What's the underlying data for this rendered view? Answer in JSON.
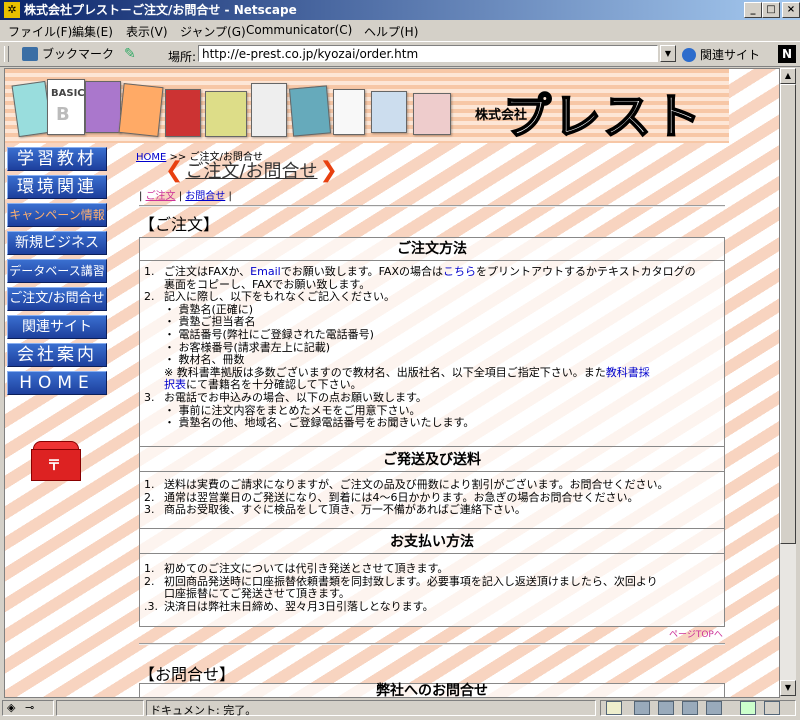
{
  "window": {
    "title": "株式会社プレスト－ご注文/お問合せ - Netscape",
    "minimize": "_",
    "maximize": "□",
    "close": "×"
  },
  "menu": [
    "ファイル(F)",
    "編集(E)",
    "表示(V)",
    "ジャンプ(G)",
    "Communicator(C)",
    "ヘルプ(H)"
  ],
  "toolbar": {
    "bookmarks": "ブックマーク",
    "location_label": "場所:",
    "location_url": "http://e-prest.co.jp/kyozai/order.htm",
    "related": "関連サイト",
    "logo": "N"
  },
  "banner": {
    "company_prefix": "株式会社",
    "company_name": "プレスト",
    "book_text": "BASIC"
  },
  "nav": [
    "学習教材",
    "環境関連",
    "キャンペーン情報",
    "新規ビジネス",
    "データベース講習",
    "ご注文/お問合せ",
    "関連サイト",
    "会社案内",
    "HOME"
  ],
  "mailbox_mark": "〒",
  "breadcrumb": {
    "home": "HOME",
    "sep": " >> ",
    "current": "ご注文/お問合せ"
  },
  "heading": {
    "title": "ご注文/お問合せ",
    "left_arrow": "❮",
    "right_arrow": "❯"
  },
  "sublinks": {
    "open": "| ",
    "order": "ご注文",
    "mid": " | ",
    "inquiry": "お問合せ",
    "close": " |"
  },
  "order_section": "【ご注文】",
  "order_method": {
    "title": "ご注文方法",
    "item1": {
      "num": "1.",
      "pre": "ご注文はFAXか、",
      "email": "Email",
      "mid": "でお願い致します。FAXの場合は",
      "here": "こちら",
      "post": "をプリントアウトするかテキストカタログの",
      "line2": "裏面をコピーし、FAXでお願い致します。"
    },
    "item2": {
      "num": "2.",
      "text": "記入に際し、以下をもれなくご記入ください。"
    },
    "bullets": [
      "・ 貴塾名(正確に)",
      "・ 貴塾ご担当者名",
      "・ 電話番号(弊社にご登録された電話番号)",
      "・ お客様番号(請求書左上に記載)",
      "・ 教材名、冊数"
    ],
    "note": {
      "pre": "※ 教科書準拠版は多数ございますので教材名、出版社名、以下全項目ご指定下さい。また",
      "link1": "教科書採",
      "link2": "択表",
      "post": "にて書籍名を十分確認して下さい。"
    },
    "item3": {
      "num": "3.",
      "text": "お電話でお申込みの場合、以下の点お願い致します。"
    },
    "bullets3": [
      "・ 事前に注文内容をまとめたメモをご用意下さい。",
      "・ 貴塾名の他、地域名、ご登録電話番号をお聞きいたします。"
    ]
  },
  "shipping": {
    "title": "ご発送及び送料",
    "items": [
      {
        "num": "1.",
        "text": "送料は実費のご請求になりますが、ご注文の品及び冊数により割引がございます。お問合せください。"
      },
      {
        "num": "2.",
        "text": "通常は翌営業日のご発送になり、到着には4～6日かかります。お急ぎの場合お問合せください。"
      },
      {
        "num": "3.",
        "text": "商品お受取後、すぐに検品をして頂き、万一不備があればご連絡下さい。"
      }
    ]
  },
  "payment": {
    "title": "お支払い方法",
    "item1": {
      "num": "1.",
      "text": "初めてのご注文については代引き発送とさせて頂きます。"
    },
    "item2": {
      "num": "2.",
      "line1": "初回商品発送時に口座振替依頼書類を同封致します。必要事項を記入し返送頂けましたら、次回より",
      "line2": "口座振替にてご発送させて頂きます。"
    },
    "item3": {
      "num": ".3.",
      "text": "決済日は弊社末日締め、翌々月3日引落しとなります。"
    }
  },
  "page_top": "ページTOPへ",
  "inquiry_section": "【お問合せ】",
  "inquiry_box_title": "弊社へのお問合せ",
  "status": {
    "text": "ドキュメント: 完了。"
  }
}
